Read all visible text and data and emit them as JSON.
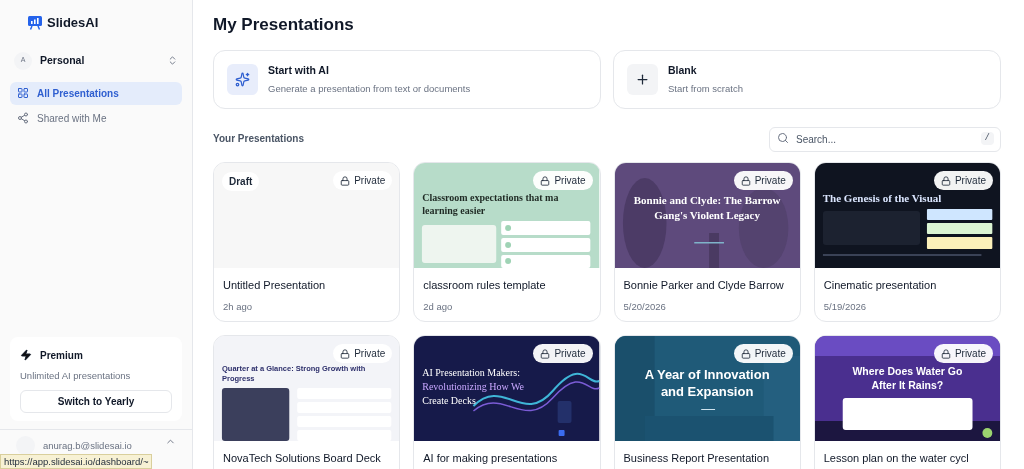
{
  "brand": {
    "name": "SlidesAI"
  },
  "workspace": {
    "avatar": "A",
    "name": "Personal"
  },
  "nav": [
    {
      "label": "All Presentations",
      "selected": true,
      "kind": "grid"
    },
    {
      "label": "Shared with Me",
      "selected": false,
      "kind": "share"
    }
  ],
  "plan": {
    "name": "Premium",
    "description": "Unlimited AI presentations",
    "button": "Switch to Yearly"
  },
  "account": {
    "email": "anurag.b@slidesai.io"
  },
  "status_tooltip": "https://app.slidesai.io/dashboard/~",
  "page_title": "My Presentations",
  "create_options": [
    {
      "kind": "ai",
      "title": "Start with AI",
      "subtitle": "Generate a presentation from text or documents"
    },
    {
      "kind": "blank",
      "title": "Blank",
      "subtitle": "Start from scratch"
    }
  ],
  "section_title": "Your Presentations",
  "search": {
    "placeholder": "Search...",
    "shortcut": "/"
  },
  "presentations": [
    {
      "title": "Untitled Presentation",
      "time": "2h ago",
      "visibility": "Private",
      "draft_label": "Draft",
      "thumbnail": {
        "kind": "blank"
      }
    },
    {
      "title": "classroom rules template",
      "time": "2d ago",
      "visibility": "Private",
      "thumbnail": {
        "kind": "mint",
        "heading": [
          "Classroom expectations that ma",
          "learning easier"
        ]
      }
    },
    {
      "title": "Bonnie Parker and Clyde Barrow",
      "time": "5/20/2026",
      "visibility": "Private",
      "thumbnail": {
        "kind": "purple",
        "heading": [
          "Bonnie and Clyde: The Barrow",
          "Gang's Violent Legacy"
        ]
      }
    },
    {
      "title": "Cinematic presentation",
      "time": "5/19/2026",
      "visibility": "Private",
      "thumbnail": {
        "kind": "dark",
        "heading": [
          "The Genesis of the Visual"
        ]
      }
    },
    {
      "title": "NovaTech Solutions Board Deck",
      "visibility": "Private",
      "thumbnail": {
        "kind": "slate",
        "heading": [
          "Quarter at a Glance: Strong Growth with",
          "Progress"
        ]
      }
    },
    {
      "title": "AI for making presentations",
      "visibility": "Private",
      "thumbnail": {
        "kind": "navy",
        "heading": [
          "AI Presentation Makers:",
          "Revolutionizing How We",
          "Create Decks"
        ]
      }
    },
    {
      "title": "Business Report Presentation",
      "visibility": "Private",
      "thumbnail": {
        "kind": "teal",
        "heading": [
          "A Year of Innovation",
          "and Expansion"
        ]
      }
    },
    {
      "title": "Lesson plan on the water cycl",
      "visibility": "Private",
      "thumbnail": {
        "kind": "violet",
        "heading": [
          "Where Does Water Go",
          "After It Rains?"
        ]
      }
    }
  ]
}
